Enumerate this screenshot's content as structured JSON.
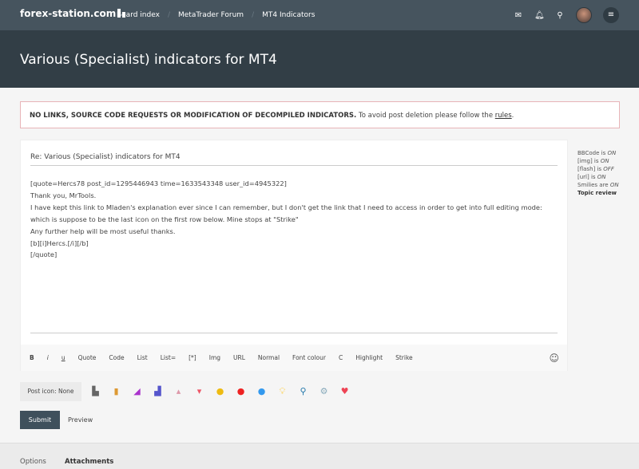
{
  "header": {
    "logo": "forex-station.com",
    "breadcrumbs": [
      "Board index",
      "MetaTrader Forum",
      "MT4 Indicators"
    ]
  },
  "page": {
    "title": "Various (Specialist) indicators for MT4"
  },
  "notice": {
    "bold": "NO LINKS, SOURCE CODE REQUESTS OR MODIFICATION OF DECOMPILED INDICATORS.",
    "text": " To avoid post deletion please follow the ",
    "link": "rules",
    "end": "."
  },
  "editor": {
    "subject": "Re: Various (Specialist) indicators for MT4",
    "lines": [
      "[quote=Hercs78 post_id=1295446943 time=1633543348 user_id=4945322]",
      "Thank you, MrTools.",
      "I have kept this link to Mladen's explanation ever since I can remember, but I don't get the link that I need to access in order to get into full editing mode: which is suppose to be the last icon on the first row below. Mine stops at \"Strike\"",
      "Any further help will be most useful thanks.",
      "[b][i]Hercs.[/i][/b]",
      "[/quote]"
    ],
    "toolbar": [
      "B",
      "i",
      "u",
      "Quote",
      "Code",
      "List",
      "List=",
      "[*]",
      "Img",
      "URL",
      "Normal",
      "Font colour",
      "C",
      "Highlight",
      "Strike"
    ]
  },
  "sidebar": {
    "items": [
      "BBCode is ",
      "ON",
      "[img] is ",
      "ON",
      "[flash] is ",
      "OFF",
      "[url] is ",
      "ON",
      "Smilies are ",
      "ON"
    ],
    "topic_review": "Topic review"
  },
  "post_icon": "Post icon: None",
  "icons": [
    "save",
    "candles",
    "chart",
    "bars",
    "thumbs-up",
    "thumbs-down",
    "info",
    "exclamation",
    "question",
    "lightbulb",
    "magnifier",
    "gear",
    "heart"
  ],
  "buttons": {
    "submit": "Submit",
    "preview": "Preview"
  },
  "tabs": [
    "Options",
    "Attachments"
  ]
}
